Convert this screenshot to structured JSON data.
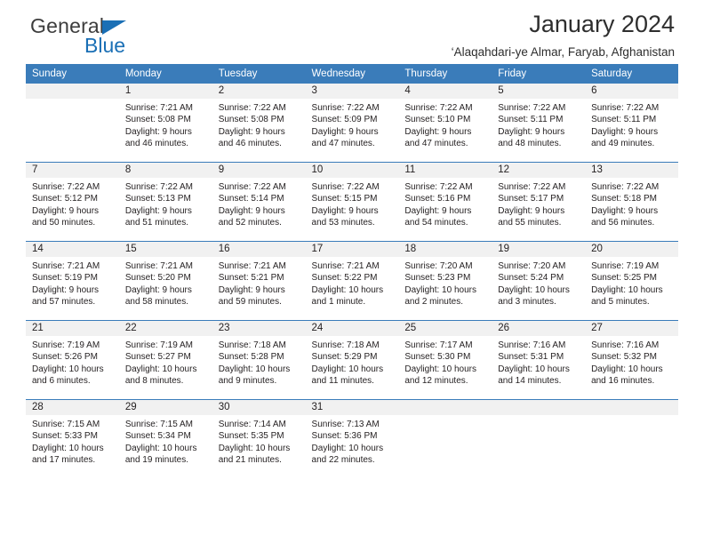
{
  "brand": {
    "name_part1": "General",
    "name_part2": "Blue",
    "triangle_color": "#1a6fb5",
    "text_color": "#3d3d3d"
  },
  "header": {
    "title": "January 2024",
    "subtitle": "‘Alaqahdari-ye Almar, Faryab, Afghanistan"
  },
  "theme": {
    "header_bg": "#3a7cba",
    "header_text": "#ffffff",
    "daynum_bg": "#f1f1f1",
    "grid_line": "#3a7cba",
    "body_text": "#231f20"
  },
  "weekdays": [
    "Sunday",
    "Monday",
    "Tuesday",
    "Wednesday",
    "Thursday",
    "Friday",
    "Saturday"
  ],
  "labels": {
    "sunrise_prefix": "Sunrise:",
    "sunset_prefix": "Sunset:",
    "daylight_prefix": "Daylight:"
  },
  "weeks": [
    [
      {
        "day": "",
        "sunrise": "",
        "sunset": "",
        "daylight_line1": "",
        "daylight_line2": ""
      },
      {
        "day": "1",
        "sunrise": "Sunrise: 7:21 AM",
        "sunset": "Sunset: 5:08 PM",
        "daylight_line1": "Daylight: 9 hours",
        "daylight_line2": "and 46 minutes."
      },
      {
        "day": "2",
        "sunrise": "Sunrise: 7:22 AM",
        "sunset": "Sunset: 5:08 PM",
        "daylight_line1": "Daylight: 9 hours",
        "daylight_line2": "and 46 minutes."
      },
      {
        "day": "3",
        "sunrise": "Sunrise: 7:22 AM",
        "sunset": "Sunset: 5:09 PM",
        "daylight_line1": "Daylight: 9 hours",
        "daylight_line2": "and 47 minutes."
      },
      {
        "day": "4",
        "sunrise": "Sunrise: 7:22 AM",
        "sunset": "Sunset: 5:10 PM",
        "daylight_line1": "Daylight: 9 hours",
        "daylight_line2": "and 47 minutes."
      },
      {
        "day": "5",
        "sunrise": "Sunrise: 7:22 AM",
        "sunset": "Sunset: 5:11 PM",
        "daylight_line1": "Daylight: 9 hours",
        "daylight_line2": "and 48 minutes."
      },
      {
        "day": "6",
        "sunrise": "Sunrise: 7:22 AM",
        "sunset": "Sunset: 5:11 PM",
        "daylight_line1": "Daylight: 9 hours",
        "daylight_line2": "and 49 minutes."
      }
    ],
    [
      {
        "day": "7",
        "sunrise": "Sunrise: 7:22 AM",
        "sunset": "Sunset: 5:12 PM",
        "daylight_line1": "Daylight: 9 hours",
        "daylight_line2": "and 50 minutes."
      },
      {
        "day": "8",
        "sunrise": "Sunrise: 7:22 AM",
        "sunset": "Sunset: 5:13 PM",
        "daylight_line1": "Daylight: 9 hours",
        "daylight_line2": "and 51 minutes."
      },
      {
        "day": "9",
        "sunrise": "Sunrise: 7:22 AM",
        "sunset": "Sunset: 5:14 PM",
        "daylight_line1": "Daylight: 9 hours",
        "daylight_line2": "and 52 minutes."
      },
      {
        "day": "10",
        "sunrise": "Sunrise: 7:22 AM",
        "sunset": "Sunset: 5:15 PM",
        "daylight_line1": "Daylight: 9 hours",
        "daylight_line2": "and 53 minutes."
      },
      {
        "day": "11",
        "sunrise": "Sunrise: 7:22 AM",
        "sunset": "Sunset: 5:16 PM",
        "daylight_line1": "Daylight: 9 hours",
        "daylight_line2": "and 54 minutes."
      },
      {
        "day": "12",
        "sunrise": "Sunrise: 7:22 AM",
        "sunset": "Sunset: 5:17 PM",
        "daylight_line1": "Daylight: 9 hours",
        "daylight_line2": "and 55 minutes."
      },
      {
        "day": "13",
        "sunrise": "Sunrise: 7:22 AM",
        "sunset": "Sunset: 5:18 PM",
        "daylight_line1": "Daylight: 9 hours",
        "daylight_line2": "and 56 minutes."
      }
    ],
    [
      {
        "day": "14",
        "sunrise": "Sunrise: 7:21 AM",
        "sunset": "Sunset: 5:19 PM",
        "daylight_line1": "Daylight: 9 hours",
        "daylight_line2": "and 57 minutes."
      },
      {
        "day": "15",
        "sunrise": "Sunrise: 7:21 AM",
        "sunset": "Sunset: 5:20 PM",
        "daylight_line1": "Daylight: 9 hours",
        "daylight_line2": "and 58 minutes."
      },
      {
        "day": "16",
        "sunrise": "Sunrise: 7:21 AM",
        "sunset": "Sunset: 5:21 PM",
        "daylight_line1": "Daylight: 9 hours",
        "daylight_line2": "and 59 minutes."
      },
      {
        "day": "17",
        "sunrise": "Sunrise: 7:21 AM",
        "sunset": "Sunset: 5:22 PM",
        "daylight_line1": "Daylight: 10 hours",
        "daylight_line2": "and 1 minute."
      },
      {
        "day": "18",
        "sunrise": "Sunrise: 7:20 AM",
        "sunset": "Sunset: 5:23 PM",
        "daylight_line1": "Daylight: 10 hours",
        "daylight_line2": "and 2 minutes."
      },
      {
        "day": "19",
        "sunrise": "Sunrise: 7:20 AM",
        "sunset": "Sunset: 5:24 PM",
        "daylight_line1": "Daylight: 10 hours",
        "daylight_line2": "and 3 minutes."
      },
      {
        "day": "20",
        "sunrise": "Sunrise: 7:19 AM",
        "sunset": "Sunset: 5:25 PM",
        "daylight_line1": "Daylight: 10 hours",
        "daylight_line2": "and 5 minutes."
      }
    ],
    [
      {
        "day": "21",
        "sunrise": "Sunrise: 7:19 AM",
        "sunset": "Sunset: 5:26 PM",
        "daylight_line1": "Daylight: 10 hours",
        "daylight_line2": "and 6 minutes."
      },
      {
        "day": "22",
        "sunrise": "Sunrise: 7:19 AM",
        "sunset": "Sunset: 5:27 PM",
        "daylight_line1": "Daylight: 10 hours",
        "daylight_line2": "and 8 minutes."
      },
      {
        "day": "23",
        "sunrise": "Sunrise: 7:18 AM",
        "sunset": "Sunset: 5:28 PM",
        "daylight_line1": "Daylight: 10 hours",
        "daylight_line2": "and 9 minutes."
      },
      {
        "day": "24",
        "sunrise": "Sunrise: 7:18 AM",
        "sunset": "Sunset: 5:29 PM",
        "daylight_line1": "Daylight: 10 hours",
        "daylight_line2": "and 11 minutes."
      },
      {
        "day": "25",
        "sunrise": "Sunrise: 7:17 AM",
        "sunset": "Sunset: 5:30 PM",
        "daylight_line1": "Daylight: 10 hours",
        "daylight_line2": "and 12 minutes."
      },
      {
        "day": "26",
        "sunrise": "Sunrise: 7:16 AM",
        "sunset": "Sunset: 5:31 PM",
        "daylight_line1": "Daylight: 10 hours",
        "daylight_line2": "and 14 minutes."
      },
      {
        "day": "27",
        "sunrise": "Sunrise: 7:16 AM",
        "sunset": "Sunset: 5:32 PM",
        "daylight_line1": "Daylight: 10 hours",
        "daylight_line2": "and 16 minutes."
      }
    ],
    [
      {
        "day": "28",
        "sunrise": "Sunrise: 7:15 AM",
        "sunset": "Sunset: 5:33 PM",
        "daylight_line1": "Daylight: 10 hours",
        "daylight_line2": "and 17 minutes."
      },
      {
        "day": "29",
        "sunrise": "Sunrise: 7:15 AM",
        "sunset": "Sunset: 5:34 PM",
        "daylight_line1": "Daylight: 10 hours",
        "daylight_line2": "and 19 minutes."
      },
      {
        "day": "30",
        "sunrise": "Sunrise: 7:14 AM",
        "sunset": "Sunset: 5:35 PM",
        "daylight_line1": "Daylight: 10 hours",
        "daylight_line2": "and 21 minutes."
      },
      {
        "day": "31",
        "sunrise": "Sunrise: 7:13 AM",
        "sunset": "Sunset: 5:36 PM",
        "daylight_line1": "Daylight: 10 hours",
        "daylight_line2": "and 22 minutes."
      },
      {
        "day": "",
        "sunrise": "",
        "sunset": "",
        "daylight_line1": "",
        "daylight_line2": ""
      },
      {
        "day": "",
        "sunrise": "",
        "sunset": "",
        "daylight_line1": "",
        "daylight_line2": ""
      },
      {
        "day": "",
        "sunrise": "",
        "sunset": "",
        "daylight_line1": "",
        "daylight_line2": ""
      }
    ]
  ]
}
